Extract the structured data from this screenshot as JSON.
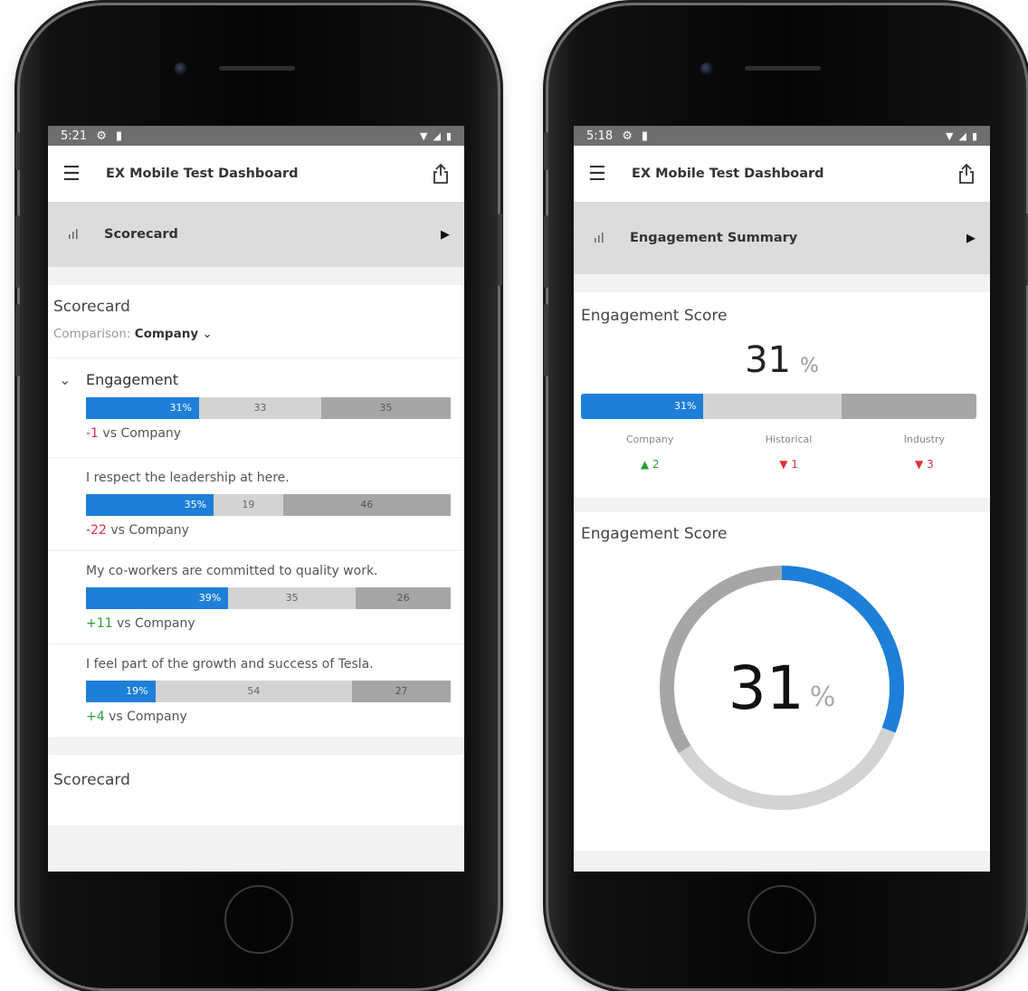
{
  "left": {
    "status": {
      "time": "5:21"
    },
    "app_title": "EX Mobile Test Dashboard",
    "page_title": "Scorecard",
    "card": {
      "title": "Scorecard",
      "comparison_label": "Comparison:",
      "comparison_value": "Company",
      "metrics": [
        {
          "label": "Engagement",
          "segments": [
            "31%",
            "33",
            "35"
          ],
          "fractions": [
            0.31,
            0.335,
            0.355
          ],
          "delta_value": "-1",
          "delta_text": "vs Company",
          "delta_sign": "neg",
          "header": true
        },
        {
          "label": "I respect the leadership at here.",
          "segments": [
            "35%",
            "19",
            "46"
          ],
          "fractions": [
            0.35,
            0.19,
            0.46
          ],
          "delta_value": "-22",
          "delta_text": "vs Company",
          "delta_sign": "neg"
        },
        {
          "label": "My co-workers are committed to quality work.",
          "segments": [
            "39%",
            "35",
            "26"
          ],
          "fractions": [
            0.39,
            0.35,
            0.26
          ],
          "delta_value": "+11",
          "delta_text": "vs Company",
          "delta_sign": "pos"
        },
        {
          "label": "I feel part of the growth and success of Tesla.",
          "segments": [
            "19%",
            "54",
            "27"
          ],
          "fractions": [
            0.19,
            0.54,
            0.27
          ],
          "delta_value": "+4",
          "delta_text": "vs Company",
          "delta_sign": "pos"
        }
      ]
    },
    "footer_title": "Scorecard"
  },
  "right": {
    "status": {
      "time": "5:18"
    },
    "app_title": "EX Mobile Test Dashboard",
    "page_title": "Engagement Summary",
    "score_card": {
      "title": "Engagement Score",
      "value": "31",
      "unit": "%",
      "bar_label": "31%",
      "fractions": [
        0.31,
        0.35,
        0.34
      ],
      "comparisons": [
        {
          "label": "Company",
          "dir": "up",
          "value": "2"
        },
        {
          "label": "Historical",
          "dir": "down",
          "value": "1"
        },
        {
          "label": "Industry",
          "dir": "down",
          "value": "3"
        }
      ]
    },
    "gauge_card": {
      "title": "Engagement Score",
      "value": "31",
      "unit": "%",
      "fractions": [
        0.31,
        0.35,
        0.34
      ]
    }
  },
  "colors": {
    "accent": "#1e7fd9",
    "light_gray": "#d3d3d3",
    "dark_gray": "#a6a6a6",
    "negative": "#e0303d",
    "positive": "#2a9d3b"
  },
  "icons": [
    "settings-icon",
    "sim-icon",
    "wifi-icon",
    "signal-icon",
    "battery-icon",
    "hamburger-menu-icon",
    "share-icon",
    "bar-chart-icon",
    "play-icon",
    "chevron-down-icon",
    "triangle-up-icon",
    "triangle-down-icon"
  ]
}
